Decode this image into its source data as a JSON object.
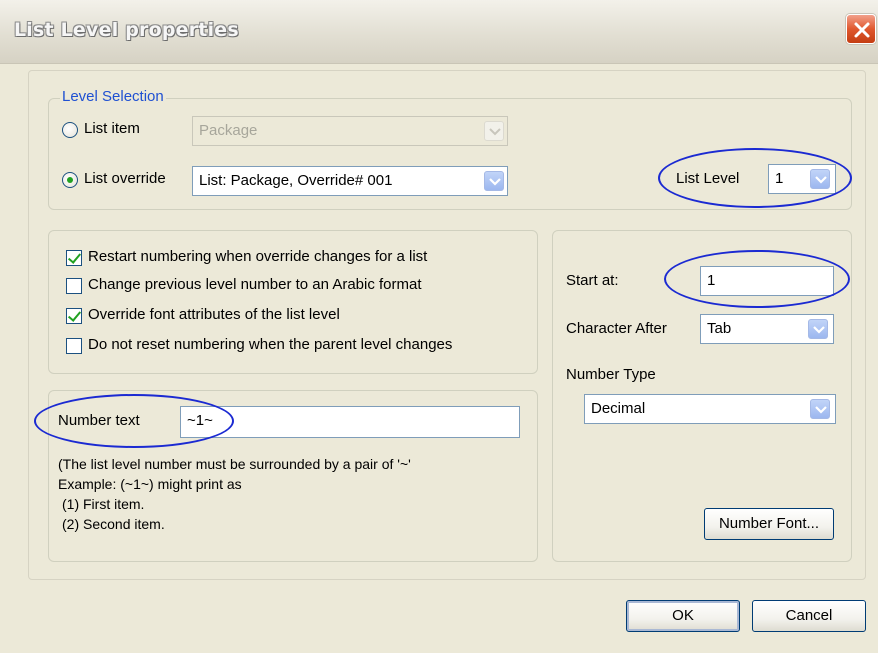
{
  "window": {
    "title": "List Level properties"
  },
  "level_selection": {
    "legend": "Level Selection",
    "list_item": {
      "label": "List item",
      "selected": false,
      "value": "Package"
    },
    "list_override": {
      "label": "List override",
      "selected": true,
      "value": "List: Package, Override# 001"
    },
    "list_level": {
      "label": "List Level",
      "value": "1"
    }
  },
  "options": [
    {
      "label": "Restart numbering when override changes for a list",
      "checked": true
    },
    {
      "label": "Change previous level number to an Arabic format",
      "checked": false
    },
    {
      "label": "Override font attributes of the list level",
      "checked": true
    },
    {
      "label": "Do not reset numbering when the parent level changes",
      "checked": false
    }
  ],
  "number_text": {
    "label": "Number text",
    "value": "~1~",
    "help": [
      "(The list level number must be surrounded by a pair of '~'",
      "Example:  (~1~) might print as",
      "  (1) First item.",
      "  (2) Second item."
    ]
  },
  "format": {
    "start_at": {
      "label": "Start at:",
      "value": "1"
    },
    "character_after": {
      "label": "Character After",
      "value": "Tab"
    },
    "number_type": {
      "label": "Number Type",
      "value": "Decimal"
    },
    "number_font_button": "Number Font..."
  },
  "buttons": {
    "ok": "OK",
    "cancel": "Cancel"
  },
  "colors": {
    "accent": "#1f50d2",
    "annotation": "#1b2ad2",
    "close": "#e0582e",
    "check": "#21a121"
  }
}
